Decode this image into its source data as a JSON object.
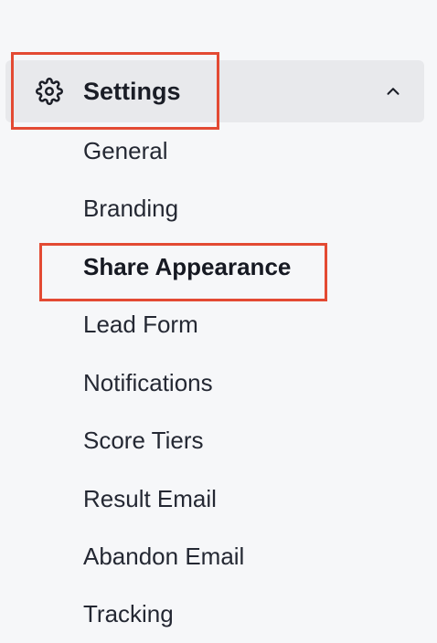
{
  "settings": {
    "label": "Settings",
    "expanded": true,
    "icon": "gear-icon",
    "toggle_icon": "chevron-up-icon"
  },
  "submenu": {
    "items": [
      {
        "label": "General",
        "active": false
      },
      {
        "label": "Branding",
        "active": false
      },
      {
        "label": "Share Appearance",
        "active": true
      },
      {
        "label": "Lead Form",
        "active": false
      },
      {
        "label": "Notifications",
        "active": false
      },
      {
        "label": "Score Tiers",
        "active": false
      },
      {
        "label": "Result Email",
        "active": false
      },
      {
        "label": "Abandon Email",
        "active": false
      },
      {
        "label": "Tracking",
        "active": false
      }
    ]
  },
  "colors": {
    "background": "#f6f7f9",
    "settings_row": "#e8e9ec",
    "text": "#242833",
    "annotation_red": "#e34a33"
  },
  "annotations": [
    {
      "target": "settings-header",
      "color": "#e34a33"
    },
    {
      "target": "share-appearance",
      "color": "#e34a33"
    }
  ]
}
